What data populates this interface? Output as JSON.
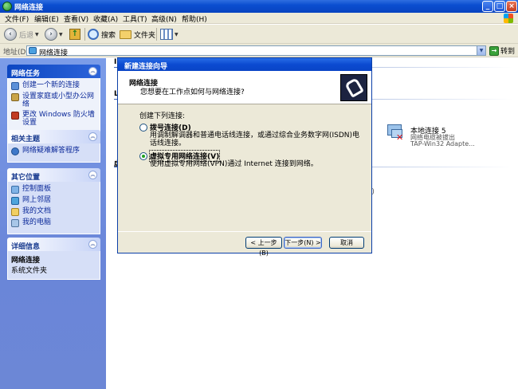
{
  "window": {
    "title": "网络连接"
  },
  "menu": [
    "文件(F)",
    "编辑(E)",
    "查看(V)",
    "收藏(A)",
    "工具(T)",
    "高级(N)",
    "帮助(H)"
  ],
  "toolbar": {
    "back": "后退",
    "search": "搜索",
    "folders": "文件夹"
  },
  "address": {
    "label": "地址(D)",
    "value": "网络连接",
    "go": "转到"
  },
  "tasks": {
    "network_tasks": {
      "title": "网络任务",
      "items": [
        "创建一个新的连接",
        "设置家庭或小型办公网络",
        "更改 Windows 防火墙设置"
      ]
    },
    "see_also": {
      "title": "相关主题",
      "items": [
        "网络疑难解答程序"
      ]
    },
    "other_places": {
      "title": "其它位置",
      "items": [
        "控制面板",
        "网上邻居",
        "我的文档",
        "我的电脑"
      ]
    },
    "details": {
      "title": "详细信息",
      "name": "网络连接",
      "type": "系统文件夹"
    }
  },
  "main": {
    "partial_heads": [
      "I",
      "L",
      "虚"
    ],
    "connection": {
      "name": "本地连接 5",
      "status": "网络电缆被拔出",
      "device": "TAP-Win32 Adapte..."
    },
    "partial_text": "P)"
  },
  "wizard": {
    "title": "新建连接向导",
    "heading": "网络连接",
    "subheading": "您想要在工作点如何与网络连接?",
    "prompt": "创建下列连接:",
    "options": [
      {
        "label": "拨号连接(D)",
        "desc": "用调制解调器和普通电话线连接，或通过综合业务数字网(ISDN)电话线连接。",
        "checked": false
      },
      {
        "label": "虚拟专用网络连接(V)",
        "desc": "使用虚拟专用网络(VPN)通过 Internet 连接到网络。",
        "checked": true
      }
    ],
    "buttons": {
      "back": "< 上一步(B)",
      "next": "下一步(N) >",
      "cancel": "取消"
    }
  }
}
